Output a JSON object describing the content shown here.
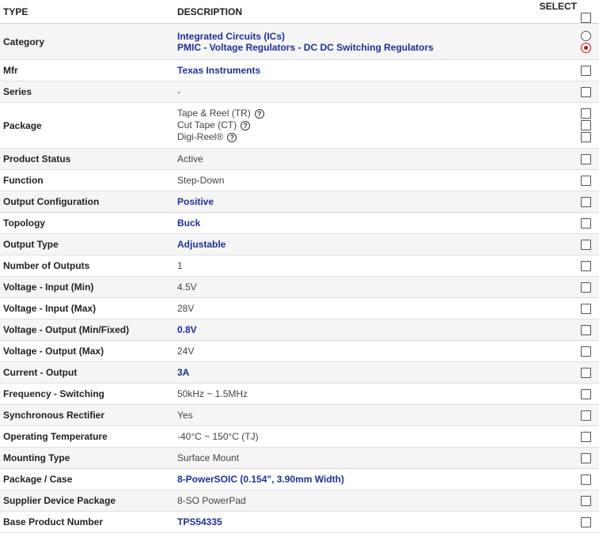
{
  "header": {
    "type": "TYPE",
    "description": "DESCRIPTION",
    "select": "SELECT"
  },
  "rows": [
    {
      "type": "Category",
      "values": [
        "Integrated Circuits (ICs)",
        "PMIC - Voltage Regulators - DC DC Switching Regulators"
      ],
      "link": true,
      "select": "radio",
      "radio_checked_index": 1
    },
    {
      "type": "Mfr",
      "value": "Texas Instruments",
      "link": true
    },
    {
      "type": "Series",
      "value": "-"
    },
    {
      "type": "Package",
      "values": [
        "Tape & Reel (TR)",
        "Cut Tape (CT)",
        "Digi-Reel®"
      ],
      "help_icon": "question-circle-icon"
    },
    {
      "type": "Product Status",
      "value": "Active"
    },
    {
      "type": "Function",
      "value": "Step-Down"
    },
    {
      "type": "Output Configuration",
      "value": "Positive",
      "link": true
    },
    {
      "type": "Topology",
      "value": "Buck",
      "link": true
    },
    {
      "type": "Output Type",
      "value": "Adjustable",
      "link": true
    },
    {
      "type": "Number of Outputs",
      "value": "1"
    },
    {
      "type": "Voltage - Input (Min)",
      "value": "4.5V"
    },
    {
      "type": "Voltage - Input (Max)",
      "value": "28V"
    },
    {
      "type": "Voltage - Output (Min/Fixed)",
      "value": "0.8V",
      "link": true
    },
    {
      "type": "Voltage - Output (Max)",
      "value": "24V"
    },
    {
      "type": "Current - Output",
      "value": "3A",
      "link": true
    },
    {
      "type": "Frequency - Switching",
      "value": "50kHz ~ 1.5MHz"
    },
    {
      "type": "Synchronous Rectifier",
      "value": "Yes"
    },
    {
      "type": "Operating Temperature",
      "value": "-40°C ~ 150°C (TJ)"
    },
    {
      "type": "Mounting Type",
      "value": "Surface Mount"
    },
    {
      "type": "Package / Case",
      "value": "8-PowerSOIC (0.154\", 3.90mm Width)",
      "link": true
    },
    {
      "type": "Supplier Device Package",
      "value": "8-SO PowerPad"
    },
    {
      "type": "Base Product Number",
      "value": "TPS54335",
      "link": true
    }
  ],
  "colors": {
    "link": "#1f2f99",
    "radio_checked": "#cc1111",
    "row_alt": "#f5f5f5"
  }
}
